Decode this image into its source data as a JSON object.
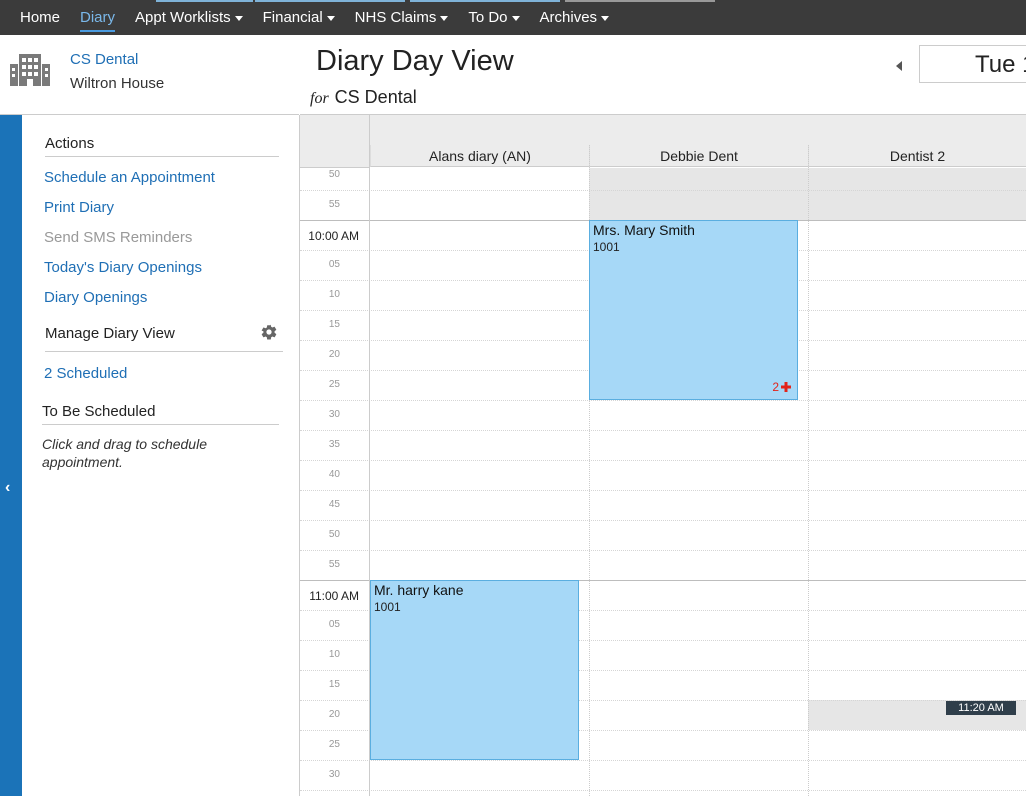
{
  "nav": {
    "items": [
      {
        "label": "Home",
        "dropdown": false
      },
      {
        "label": "Diary",
        "dropdown": false,
        "active": true
      },
      {
        "label": "Appt Worklists",
        "dropdown": true
      },
      {
        "label": "Financial",
        "dropdown": true
      },
      {
        "label": "NHS Claims",
        "dropdown": true
      },
      {
        "label": "To Do",
        "dropdown": true
      },
      {
        "label": "Archives",
        "dropdown": true
      }
    ]
  },
  "practice": {
    "name": "CS Dental",
    "address": "Wiltron House",
    "icon": "building-icon"
  },
  "header": {
    "title": "Diary Day View",
    "for_prefix": "for",
    "practice": "CS Dental",
    "date": "Tue 1"
  },
  "sidebar": {
    "actions_title": "Actions",
    "actions": [
      {
        "label": "Schedule an Appointment",
        "enabled": true
      },
      {
        "label": "Print Diary",
        "enabled": true
      },
      {
        "label": "Send SMS Reminders",
        "enabled": false
      },
      {
        "label": "Today's Diary Openings",
        "enabled": true
      },
      {
        "label": "Diary Openings",
        "enabled": true
      }
    ],
    "manage_title": "Manage Diary View",
    "scheduled_link": "2 Scheduled",
    "to_be_scheduled_title": "To Be Scheduled",
    "hint": "Click and drag to schedule appointment."
  },
  "diary": {
    "columns": [
      "Alans diary (AN)",
      "Debbie Dent",
      "Dentist 2"
    ],
    "time_labels": [
      "50",
      "55",
      "10:00 AM",
      "05",
      "10",
      "15",
      "20",
      "25",
      "30",
      "35",
      "40",
      "45",
      "50",
      "55",
      "11:00 AM",
      "05",
      "10",
      "15",
      "20",
      "25",
      "30"
    ],
    "appointments": [
      {
        "patient": "Mrs. Mary Smith",
        "code": "1001",
        "column": "Debbie Dent",
        "start": "10:00 AM",
        "end": "10:30 AM",
        "count": "2"
      },
      {
        "patient": "Mr. harry kane",
        "code": "1001",
        "column": "Alans diary (AN)",
        "start": "11:00 AM",
        "end": "11:30 AM"
      }
    ],
    "current_time": "11:20 AM"
  },
  "colors": {
    "nav_bg": "#3b3b3b",
    "accent": "#1b73b8",
    "appointment": "#a6d8f7",
    "alert_red": "#e2231a"
  }
}
